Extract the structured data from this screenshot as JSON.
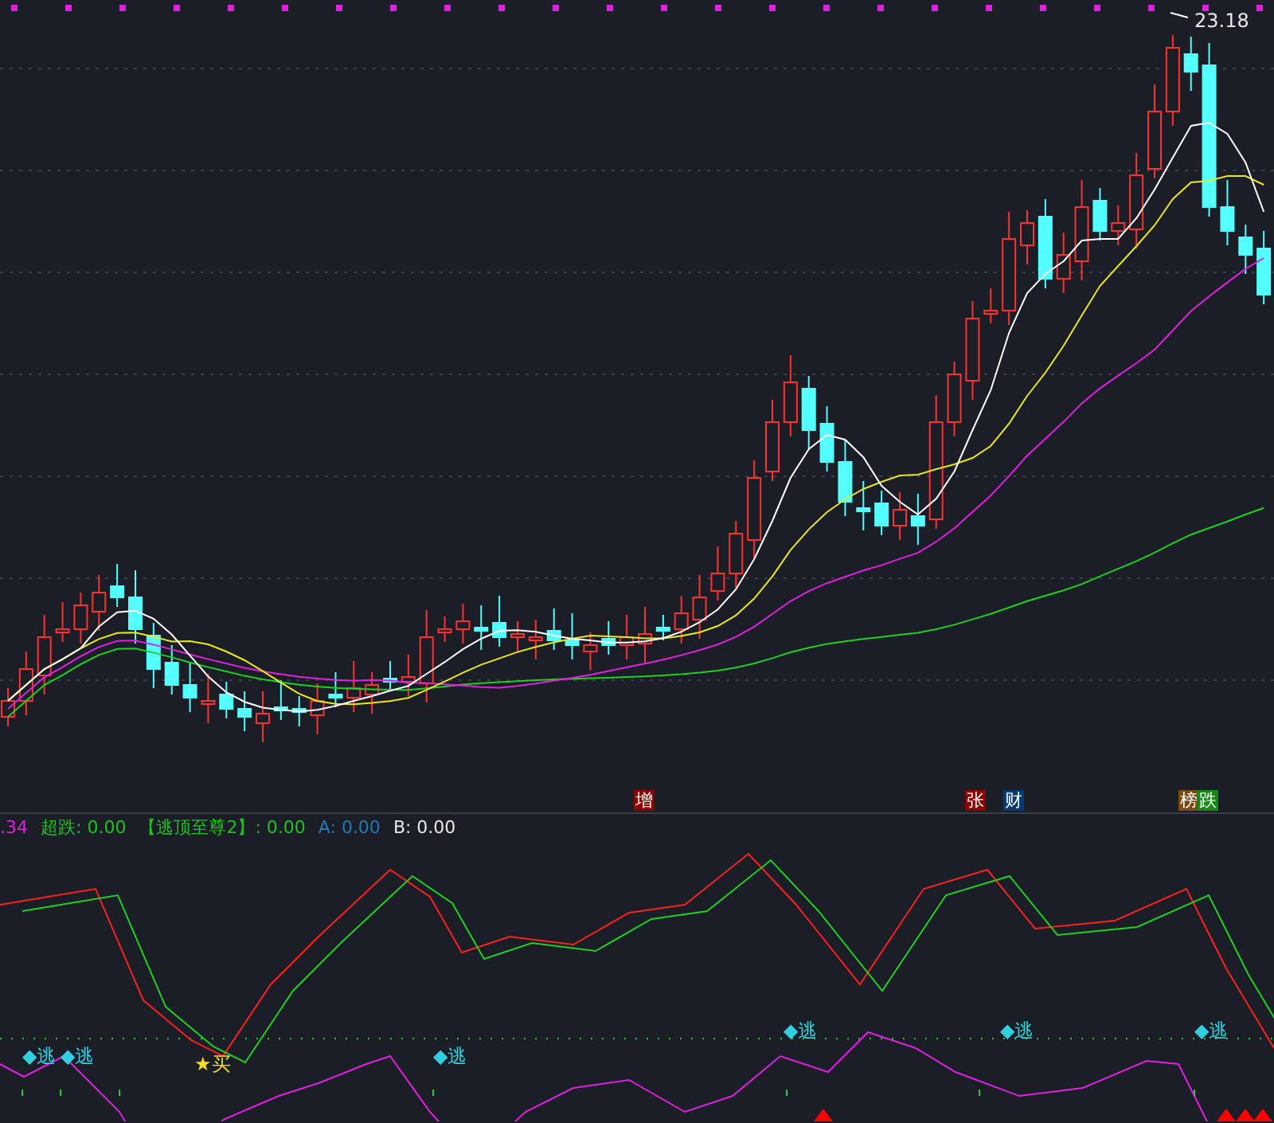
{
  "price_chart": {
    "high_label": "23.18",
    "tags": [
      {
        "text": "增",
        "color": "#8b0000"
      },
      {
        "text": "张",
        "color": "#8b0000"
      },
      {
        "text": "财",
        "color": "#0a3a6e"
      },
      {
        "text": "榜",
        "color": "#7a4a10"
      },
      {
        "text": "跌",
        "color": "#138a13"
      }
    ]
  },
  "indicator_legend": [
    {
      "text": ".34",
      "color": "#e020e0"
    },
    {
      "text": "超跌: 0.00",
      "color": "#20c020"
    },
    {
      "text": "【逃顶至尊2】: 0.00",
      "color": "#20c020"
    },
    {
      "text": "A: 0.00",
      "color": "#1f7ab8"
    },
    {
      "text": "B: 0.00",
      "color": "#e8e8e8"
    }
  ],
  "signals": [
    {
      "kind": "escape",
      "text": "◆逃"
    },
    {
      "kind": "escape",
      "text": "◆逃"
    },
    {
      "kind": "buy",
      "text": "★买"
    },
    {
      "kind": "escape",
      "text": "◆逃"
    },
    {
      "kind": "escape",
      "text": "◆逃"
    },
    {
      "kind": "escape",
      "text": "◆逃"
    },
    {
      "kind": "escape",
      "text": "◆逃"
    }
  ]
}
